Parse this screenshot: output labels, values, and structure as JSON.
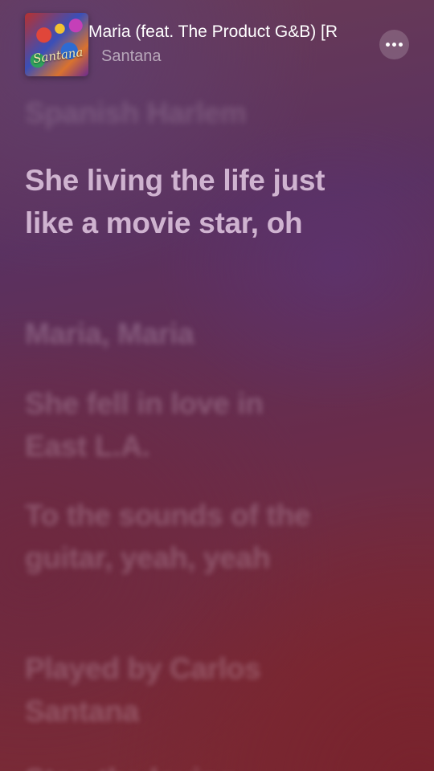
{
  "now_playing": {
    "title": "Maria (feat. The Product G&B) [R",
    "artist": "Santana",
    "artwork_text": "Santana"
  },
  "lyrics": [
    "Spanish Harlem",
    "She living the life just like a movie star, oh",
    "Maria, Maria",
    "She fell in love in East L.A.",
    "To the sounds of the guitar, yeah, yeah",
    "Played by Carlos Santana",
    "Stop the loving"
  ],
  "active_line_index": 1,
  "colors": {
    "background_top": "#5a3160",
    "background_bottom": "#7a2a36",
    "active_lyric": "#e2c8e2",
    "inactive_lyric": "#ecd6e8"
  },
  "icons": {
    "more": "ellipsis-icon"
  }
}
